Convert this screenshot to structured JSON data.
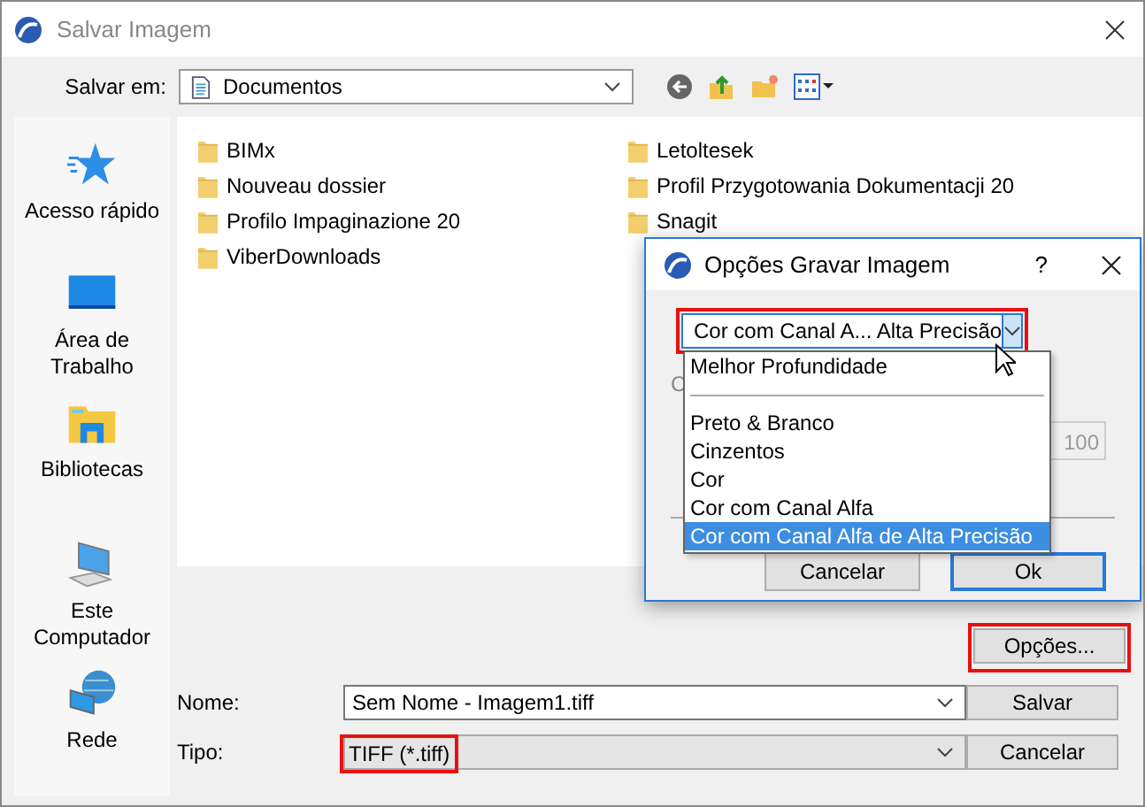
{
  "window": {
    "title": "Salvar Imagem"
  },
  "location": {
    "label": "Salvar em:",
    "value": "Documentos"
  },
  "sidebar": {
    "items": [
      {
        "label": "Acesso rápido",
        "kind": "star"
      },
      {
        "label": "Área de Trabalho",
        "kind": "desktop"
      },
      {
        "label": "Bibliotecas",
        "kind": "library"
      },
      {
        "label": "Este Computador",
        "kind": "computer"
      },
      {
        "label": "Rede",
        "kind": "network"
      }
    ]
  },
  "files": [
    {
      "name": "BIMx"
    },
    {
      "name": "Nouveau dossier"
    },
    {
      "name": "Profilo Impaginazione 20"
    },
    {
      "name": "ViberDownloads"
    },
    {
      "name": "Letoltesek"
    },
    {
      "name": "Profil Przygotowania Dokumentacji 20"
    },
    {
      "name": "Snagit"
    }
  ],
  "options_button": {
    "label": "Opções...",
    "highlighted": true
  },
  "name_field": {
    "label": "Nome:",
    "value": "Sem Nome - Imagem1.tiff"
  },
  "type_field": {
    "label": "Tipo:",
    "value": "TIFF (*.tiff)",
    "highlighted": true
  },
  "buttons": [
    "Salvar",
    "Cancelar"
  ],
  "options_dialog": {
    "title": "Opções Gravar Imagem",
    "help": "?",
    "combo": {
      "value": "Cor com Canal A... Alta Precisão",
      "highlighted": true
    },
    "hidden_label": "C",
    "quality_value": "100",
    "options": [
      {
        "label": "Melhor Profundidade",
        "selected": false
      },
      {
        "kind": "separator"
      },
      {
        "label": "Preto & Branco",
        "selected": false
      },
      {
        "label": "Cinzentos",
        "selected": false
      },
      {
        "label": "Cor",
        "selected": false
      },
      {
        "label": "Cor com Canal Alfa",
        "selected": false
      },
      {
        "label": "Cor com Canal Alfa de Alta Precisão",
        "selected": true
      }
    ],
    "buttons": [
      "Cancelar",
      "Ok"
    ]
  }
}
